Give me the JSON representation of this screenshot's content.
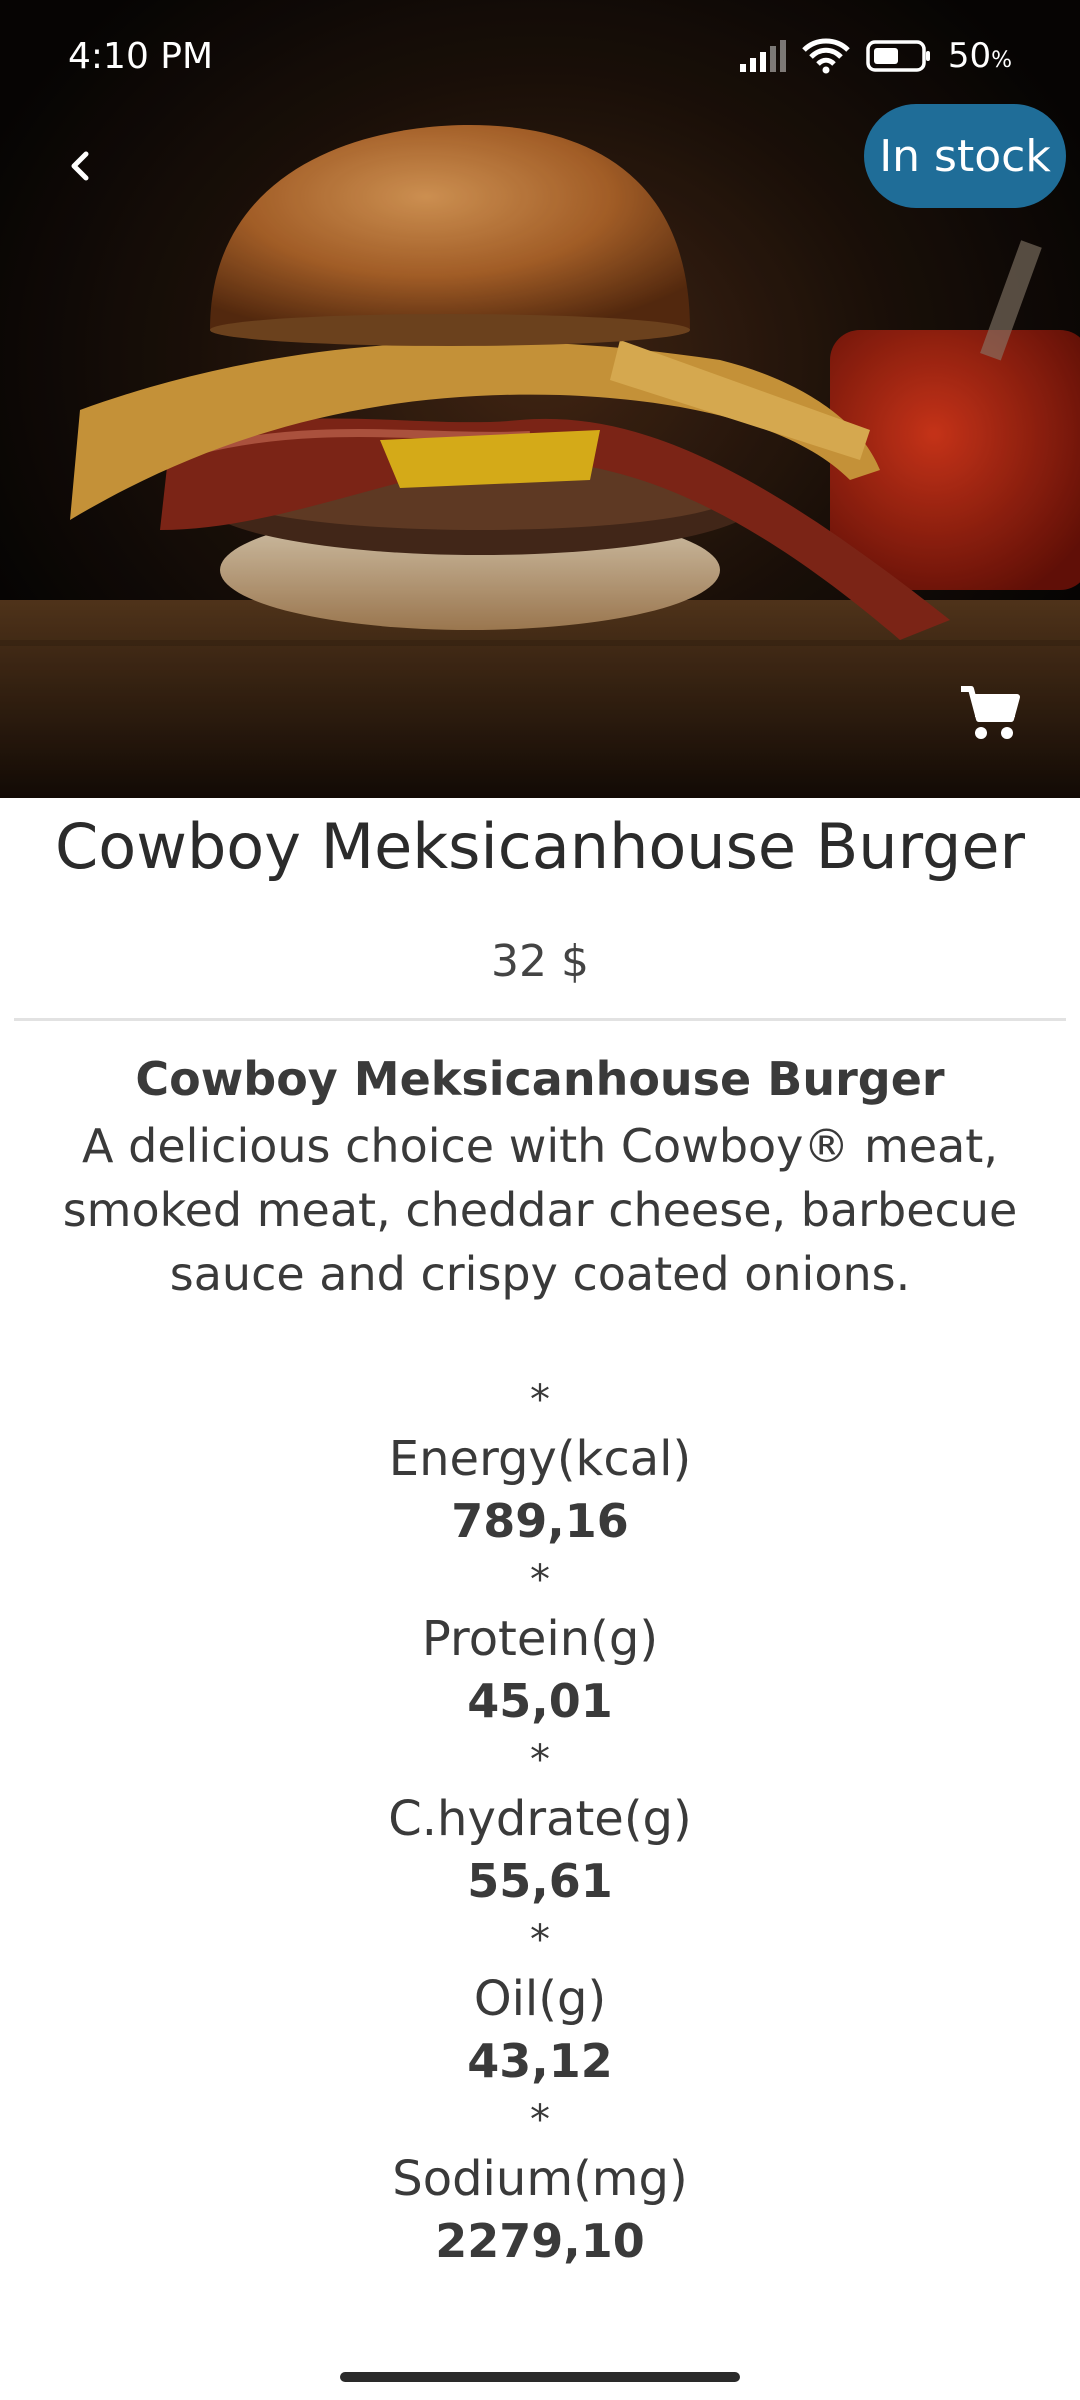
{
  "status_bar": {
    "time": "4:10 PM",
    "battery": "50"
  },
  "hero": {
    "badge": "In stock"
  },
  "product": {
    "title": "Cowboy Meksicanhouse Burger",
    "price": "32 $",
    "description_title": "Cowboy Meksicanhouse Burger",
    "description": "A delicious choice with Cowboy® meat, smoked meat, cheddar cheese, barbecue sauce and crispy coated onions."
  },
  "nutrition": [
    {
      "star": "*",
      "label": "Energy(kcal)",
      "value": "789,16"
    },
    {
      "star": "*",
      "label": "Protein(g)",
      "value": "45,01"
    },
    {
      "star": "*",
      "label": "C.hydrate(g)",
      "value": "55,61"
    },
    {
      "star": "*",
      "label": "Oil(g)",
      "value": "43,12"
    },
    {
      "star": "*",
      "label": "Sodium(mg)",
      "value": "2279,10"
    }
  ],
  "colors": {
    "badge": "#1f6d98",
    "text": "#3a3a3a"
  },
  "icons": {
    "back": "chevron-left-icon",
    "cart": "shopping-cart-icon",
    "signal": "signal-icon",
    "wifi": "wifi-icon",
    "battery": "battery-icon"
  }
}
